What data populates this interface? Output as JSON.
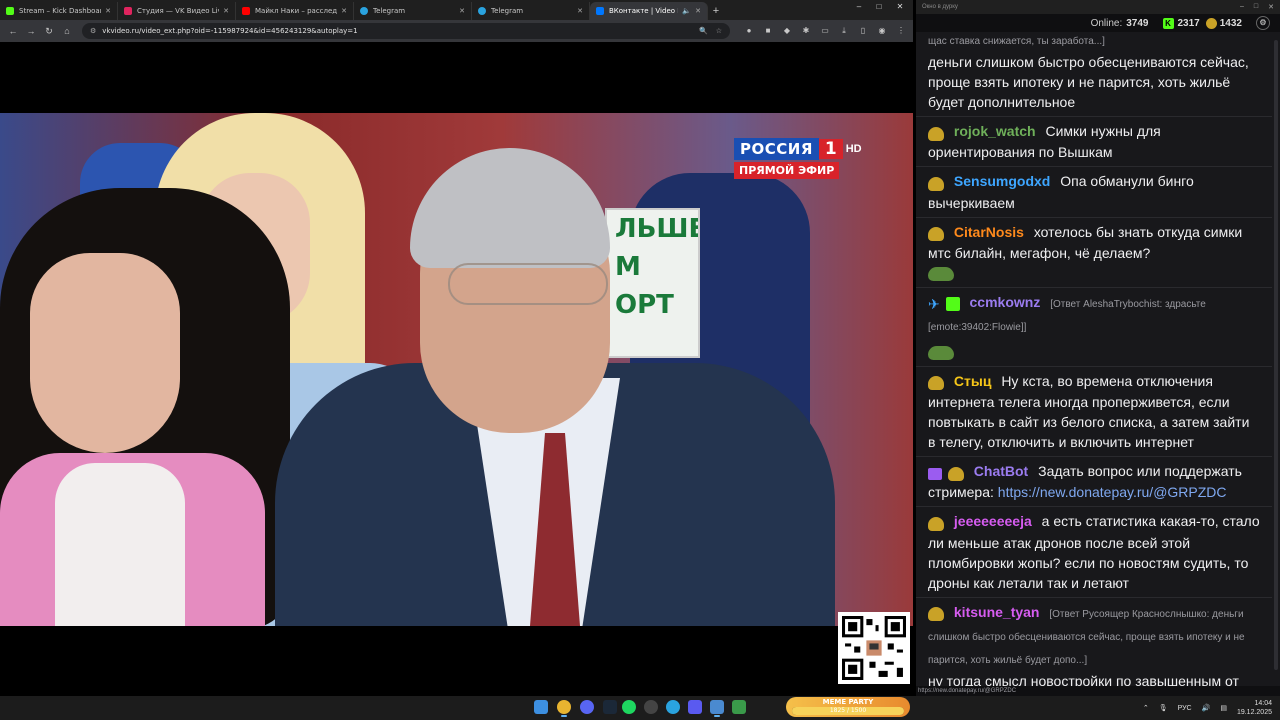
{
  "browser": {
    "tabs": [
      {
        "label": "Stream – Kick Dashboard",
        "color": "#53fc18"
      },
      {
        "label": "Студия — VK Видео Live",
        "color": "#e0245e"
      },
      {
        "label": "Майкл Наки – расследовани",
        "color": "#ff0000"
      },
      {
        "label": "Telegram",
        "color": "#2aa3df"
      },
      {
        "label": "Telegram",
        "color": "#2aa3df"
      },
      {
        "label": "ВКонтакте | Video Ext",
        "color": "#0077ff"
      }
    ],
    "new_tab": "+",
    "url": "vkvideo.ru/video_ext.php?oid=-115987924&id=456243129&autoplay=1",
    "window_controls": [
      "–",
      "□",
      "✕"
    ]
  },
  "broadcast": {
    "channel": "РОССИЯ",
    "channel_num": "1",
    "hd": "HD",
    "live": "ПРЯМОЙ ЭФИР",
    "sign_lines": [
      "ЛЬШЕ",
      "М",
      "ОРТ"
    ]
  },
  "chat_window": {
    "title": "Окно в дурку",
    "online_label": "Online:",
    "online": "3749",
    "kick_count": "2317",
    "coin_count": "1432"
  },
  "chat": [
    {
      "user": "",
      "user_color": "#efeff1",
      "reply": "щас ставка снижается, ты заработа...]",
      "text": "деньги слишком быстро обесцениваются сейчас, проще взять ипотеку и не парится, хоть жильё будет дополнительное"
    },
    {
      "user": "rojok_watch",
      "user_color": "#6fb05a",
      "reply": "",
      "text": "Симки нужны для ориентирования по Вышкам"
    },
    {
      "user": "Sensumgodxd",
      "user_color": "#3ea6ff",
      "reply": "",
      "text": "Опа обманули бинго вычеркиваем"
    },
    {
      "user": "CitarNosis",
      "user_color": "#ff8a1c",
      "reply": "",
      "text": "хотелось бы знать откуда симки мтс билайн, мегафон, чё делаем?"
    },
    {
      "user": "ccmkownz",
      "user_color": "#9b7cf0",
      "reply": "[Ответ AleshaTrybochist: здрасьте [emote:39402:Flowie]]",
      "text": ""
    },
    {
      "user": "Стыц",
      "user_color": "#f5c518",
      "reply": "",
      "text": "Ну кста, во времена отключения интернета телега иногда проперживется, если повтыкать в сайт из белого списка, а затем зайти в телегу, отключить и включить интернет"
    },
    {
      "user": "ChatBot",
      "user_color": "#9b7cf0",
      "reply": "",
      "text": "Задать вопрос или поддержать стримера:",
      "link": "https://new.donatepay.ru/@GRPZDC"
    },
    {
      "user": "jeeeeeeeeja",
      "user_color": "#d65cf0",
      "reply": "",
      "text": "а есть статистика какая-то, стало ли меньше атак дронов после всей этой пломбировки жопы? если по новостям судить, то дроны как летали так и летают"
    },
    {
      "user": "kitsune_tyan",
      "user_color": "#d65cf0",
      "reply": "[Ответ Русоящер Краснослнышко: деньги слишком быстро обесцениваются сейчас, проще взять ипотеку и не парится, хоть жильё будет допо...]",
      "text": "ну тогда смысл новостройки по завышенным от застройщика ценам, просто потому что боишься бабок скамщиц?"
    }
  ],
  "chat_status": "https://new.donatepay.ru/@GRPZDC",
  "taskbar": {
    "meme_title": "MEME PARTY",
    "meme_progress": "1825 / 1500",
    "meme_fill": 1.0,
    "lang": "РУС",
    "time": "14:04",
    "date": "19.12.2025"
  }
}
